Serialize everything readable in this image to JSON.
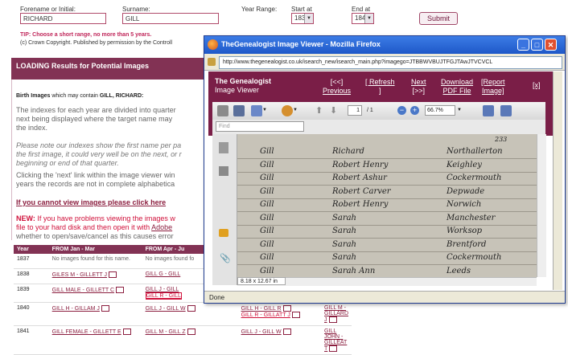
{
  "search": {
    "forename_label": "Forename or Initial:",
    "forename_value": "RICHARD",
    "surname_label": "Surname:",
    "surname_value": "GILL",
    "year_range_label": "Year Range:",
    "start_label": "Start at",
    "start_value": "1837",
    "end_label": "End at",
    "end_value": "1842",
    "submit_label": "Submit",
    "tip": "TIP: Choose a short range, no more than 5 years.",
    "copyright": "(c) Crown Copyright. Published by permission by the Controll"
  },
  "results": {
    "loading_heading": "LOADING Results for Potential Images",
    "birth_label": "Birth Images",
    "birth_text": " which may contain ",
    "birth_name": "GILL, RICHARD:",
    "para1_line1": "The indexes for each year are divided into quarter",
    "para1_line2": "next being displayed where the target name may",
    "para1_line3": "the index.",
    "para2_line1": "Please note our indexes show the first name per pa",
    "para2_line2": "the first image, it could very well be on the next, or r",
    "para2_line3": "beginning or end of that quarter.",
    "para3_line1": "Clicking the 'next' link within the image viewer win",
    "para3_line2": "years the records are not in complete alphabetica",
    "cannot_view_link": "If you cannot view images please click here",
    "new_label": "NEW:",
    "new_line1": " If you have problems viewing the images w",
    "new_line2": "file to your hard disk and then open it with ",
    "new_line2_link": "Adobe",
    "new_line3": "whether to open/save/cancel as this causes error",
    "table": {
      "headers": [
        "Year",
        "FROM Jan - Mar",
        "FROM Apr - Ju",
        "",
        ""
      ],
      "rows": [
        {
          "year": "1837",
          "c1": "No images found for this name.",
          "c2": "No images found fo",
          "c3": "",
          "c4": ""
        },
        {
          "year": "1838",
          "c1": "GILES M - GILLETT J",
          "c2": "GILL G - GILL",
          "c3": "",
          "c4": ""
        },
        {
          "year": "1839",
          "c1": "GILL MALE - GILLETT C",
          "c2": "GILL J - GILL",
          "c2b": "GILL R - GILL",
          "c3": "",
          "c4": ""
        },
        {
          "year": "1840",
          "c1": "GILL H - GILLAM J",
          "c2": "GILL J - GILL W",
          "c3": "GILL H - GILL R",
          "c3b": "GILL R - GILLATT J",
          "c4": "GILL M - GILLARD J"
        },
        {
          "year": "1841",
          "c1": "GILL FEMALE - GILLETT E",
          "c2": "GILL M - GILL Z",
          "c3": "GILL J - GILL W",
          "c4": "GILL JOHN - GILLEAT T"
        }
      ]
    }
  },
  "viewer": {
    "window_title": "TheGenealogist Image Viewer - Mozilla Firefox",
    "url": "http://www.thegenealogist.co.uk/isearch_new/isearch_main.php?imagego=JTBBWVBUJTFGJTAwJTVCVCL",
    "brand_line1": "The Genealogist",
    "brand_line2": "Image Viewer",
    "nav_prev_1": "[<<]",
    "nav_prev_2": "Previous",
    "nav_refresh_1": "[ Refresh",
    "nav_refresh_2": "]",
    "nav_next_1": "Next",
    "nav_next_2": "[>>]",
    "nav_download_1": "Download",
    "nav_download_2": "PDF File",
    "nav_report_1": "[Report",
    "nav_report_2": "Image]",
    "nav_close": "[x]",
    "page_current": "1",
    "page_total": "/ 1",
    "zoom": "66.7%",
    "find_placeholder": "Find",
    "page_size": "8.18 x 12.67 in",
    "status": "Done",
    "register_number": "233",
    "register": [
      {
        "surname": "Gill",
        "forename": "Richard",
        "district": "Northallerton"
      },
      {
        "surname": "Gill",
        "forename": "Robert Henry",
        "district": "Keighley"
      },
      {
        "surname": "Gill",
        "forename": "Robert Ashur",
        "district": "Cockermouth"
      },
      {
        "surname": "Gill",
        "forename": "Robert Carver",
        "district": "Depwade"
      },
      {
        "surname": "Gill",
        "forename": "Robert Henry",
        "district": "Norwich"
      },
      {
        "surname": "Gill",
        "forename": "Sarah",
        "district": "Manchester"
      },
      {
        "surname": "Gill",
        "forename": "Sarah",
        "district": "Worksop"
      },
      {
        "surname": "Gill",
        "forename": "Sarah",
        "district": "Brentford"
      },
      {
        "surname": "Gill",
        "forename": "Sarah",
        "district": "Cockermouth"
      },
      {
        "surname": "Gill",
        "forename": "Sarah Ann",
        "district": "Leeds"
      }
    ]
  }
}
